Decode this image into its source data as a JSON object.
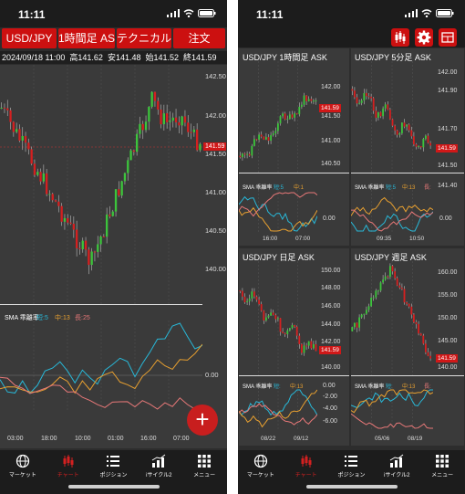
{
  "left": {
    "status": {
      "time": "11:11"
    },
    "toolbar": {
      "pair": "USD/JPY",
      "timeframe": "1時間足 ASK",
      "technical": "テクニカル",
      "order": "注文"
    },
    "ohlc": {
      "datetime": "2024/09/18 11:00",
      "high": "高141.62",
      "low": "安141.48",
      "open": "始141.52",
      "close": "終141.59"
    },
    "price_axis": [
      "142.50",
      "142.00",
      "141.50",
      "141.00",
      "140.50",
      "140.00"
    ],
    "current_price": "141.59",
    "indicator": {
      "name": "SMA 乖離率",
      "short": "短:5",
      "mid": "中:13",
      "long": "長:25",
      "zero": "0.00"
    },
    "time_axis": [
      "03:00",
      "18:00",
      "10:00",
      "01:00",
      "16:00",
      "07:00"
    ],
    "fab": "+"
  },
  "right": {
    "status": {
      "time": "11:11"
    },
    "panels": [
      {
        "title": "USD/JPY 1時間足 ASK",
        "prices": [
          "142.00",
          "141.50",
          "141.00",
          "140.50"
        ],
        "current": "141.59",
        "ind": "SMA 乖離率",
        "ind_s": "短:5",
        "ind_m": "中:1",
        "zero": "0.00",
        "dates": [
          "16:00",
          "07:00"
        ]
      },
      {
        "title": "USD/JPY 5分足 ASK",
        "prices": [
          "142.00",
          "141.90",
          "141.70",
          "141.50",
          "141.40"
        ],
        "current": "141.59",
        "ind": "SMA 乖離率",
        "ind_s": "短:5",
        "ind_m": "中:13",
        "ind_l": "長:",
        "zero": "0.00",
        "dates": [
          "09:35",
          "10:50"
        ]
      },
      {
        "title": "USD/JPY 日足 ASK",
        "prices": [
          "150.00",
          "148.00",
          "146.00",
          "144.00",
          "142.00",
          "140.00"
        ],
        "current": "141.59",
        "ind": "SMA 乖離率",
        "ind_s": "短:",
        "ind_m": "中:13",
        "extra": [
          "0.00",
          "-2.00",
          "-4.00",
          "-6.00"
        ],
        "dates": [
          "08/22",
          "09/12"
        ]
      },
      {
        "title": "USD/JPY 週足 ASK",
        "prices": [
          "160.00",
          "155.00",
          "150.00",
          "145.00",
          "140.00"
        ],
        "current": "141.59",
        "ind": "SMA 乖離率",
        "ind_s": "短:",
        "ind_m": "中:13",
        "ind_l": "長:",
        "dates": [
          "05/06",
          "08/19"
        ]
      }
    ]
  },
  "tabs": [
    {
      "label": "マーケット",
      "icon": "globe-icon"
    },
    {
      "label": "チャート",
      "icon": "candlestick-icon"
    },
    {
      "label": "ポジション",
      "icon": "list-icon"
    },
    {
      "label": "iサイクル2",
      "icon": "bar-chart-icon"
    },
    {
      "label": "メニュー",
      "icon": "grid-icon"
    }
  ],
  "colors": {
    "up": "#3cc43c",
    "down": "#d42020",
    "accent": "#cc1010",
    "short": "#28b8d8",
    "mid": "#e8a030",
    "long": "#e87878"
  }
}
